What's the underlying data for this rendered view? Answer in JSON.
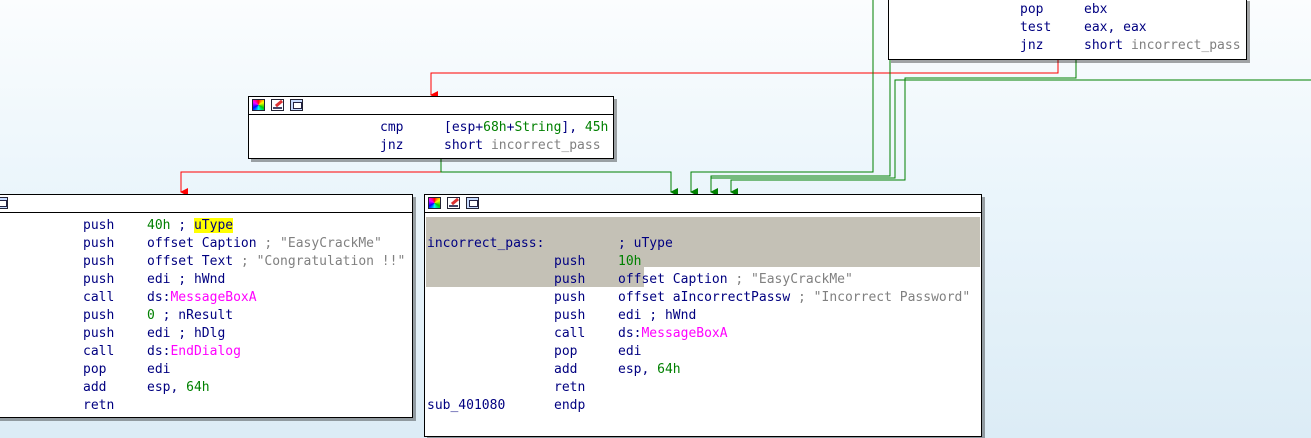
{
  "top_block": {
    "lines": [
      {
        "mn": "pop",
        "op": [
          {
            "t": "ebx",
            "c": "op"
          }
        ]
      },
      {
        "mn": "test",
        "op": [
          {
            "t": "eax, eax",
            "c": "op"
          }
        ]
      },
      {
        "mn": "jnz",
        "op": [
          {
            "t": "short ",
            "c": "op"
          },
          {
            "t": "incorrect_pass",
            "c": "cmt"
          }
        ]
      }
    ]
  },
  "cmp_block": {
    "lines": [
      {
        "mn": "cmp",
        "op": [
          {
            "t": "[esp+",
            "c": "op"
          },
          {
            "t": "68h",
            "c": "num"
          },
          {
            "t": "+",
            "c": "op"
          },
          {
            "t": "String",
            "c": "num"
          },
          {
            "t": "], ",
            "c": "op"
          },
          {
            "t": "45h",
            "c": "num"
          }
        ]
      },
      {
        "mn": "jnz",
        "op": [
          {
            "t": "short ",
            "c": "op"
          },
          {
            "t": "incorrect_pass",
            "c": "cmt"
          }
        ]
      }
    ]
  },
  "success_block": {
    "lines": [
      {
        "mn": "push",
        "op": [
          {
            "t": "40h",
            "c": "num"
          },
          {
            "t": " ; ",
            "c": "op"
          },
          {
            "t": "uType",
            "c": "op hlw"
          }
        ]
      },
      {
        "mn": "push",
        "op": [
          {
            "t": "offset Caption",
            "c": "op"
          },
          {
            "t": " ; \"EasyCrackMe\"",
            "c": "cmt"
          }
        ]
      },
      {
        "mn": "push",
        "op": [
          {
            "t": "offset Text",
            "c": "op"
          },
          {
            "t": " ; \"Congratulation !!\"",
            "c": "cmt"
          }
        ]
      },
      {
        "mn": "push",
        "op": [
          {
            "t": "edi ; hWnd",
            "c": "op"
          }
        ]
      },
      {
        "mn": "call",
        "op": [
          {
            "t": "ds:",
            "c": "op"
          },
          {
            "t": "MessageBoxA",
            "c": "fn"
          }
        ]
      },
      {
        "mn": "push",
        "op": [
          {
            "t": "0",
            "c": "num"
          },
          {
            "t": " ; nResult",
            "c": "op"
          }
        ]
      },
      {
        "mn": "push",
        "op": [
          {
            "t": "edi ; hDlg",
            "c": "op"
          }
        ]
      },
      {
        "mn": "call",
        "op": [
          {
            "t": "ds:",
            "c": "op"
          },
          {
            "t": "EndDialog",
            "c": "fn"
          }
        ]
      },
      {
        "mn": "pop",
        "op": [
          {
            "t": "edi",
            "c": "op"
          }
        ]
      },
      {
        "mn": "add",
        "op": [
          {
            "t": "esp, ",
            "c": "op"
          },
          {
            "t": "64h",
            "c": "num"
          }
        ]
      },
      {
        "mn": "retn",
        "op": []
      }
    ]
  },
  "fail_block": {
    "lines": [
      {
        "label": "incorrect_pass:",
        "mn": "",
        "op": [
          {
            "t": "; uType",
            "c": "op"
          }
        ]
      },
      {
        "mn": "push",
        "op": [
          {
            "t": "10h",
            "c": "num"
          }
        ]
      },
      {
        "mn": "push",
        "op": [
          {
            "t": "offset Caption",
            "c": "op"
          },
          {
            "t": " ; \"EasyCrackMe\"",
            "c": "cmt"
          }
        ]
      },
      {
        "mn": "push",
        "op": [
          {
            "t": "offset aIncorrectPassw",
            "c": "op"
          },
          {
            "t": " ; \"Incorrect Password\"",
            "c": "cmt"
          }
        ]
      },
      {
        "mn": "push",
        "op": [
          {
            "t": "edi ; hWnd",
            "c": "op"
          }
        ]
      },
      {
        "mn": "call",
        "op": [
          {
            "t": "ds:",
            "c": "op"
          },
          {
            "t": "MessageBoxA",
            "c": "fn"
          }
        ]
      },
      {
        "mn": "pop",
        "op": [
          {
            "t": "edi",
            "c": "op"
          }
        ]
      },
      {
        "mn": "add",
        "op": [
          {
            "t": "esp, ",
            "c": "op"
          },
          {
            "t": "64h",
            "c": "num"
          }
        ]
      },
      {
        "mn": "retn",
        "op": []
      },
      {
        "label": "sub_401080",
        "mn": "endp",
        "op": []
      }
    ]
  },
  "header_icons": [
    "color-icon",
    "pencil-icon",
    "graph-icon"
  ],
  "colors": {
    "edge_false": "#ff0000",
    "edge_true": "#008000",
    "selection": "#c4c1b6",
    "mnemonic": "#000080",
    "immediate": "#008000",
    "comment": "#808080",
    "import": "#ff00ff"
  }
}
